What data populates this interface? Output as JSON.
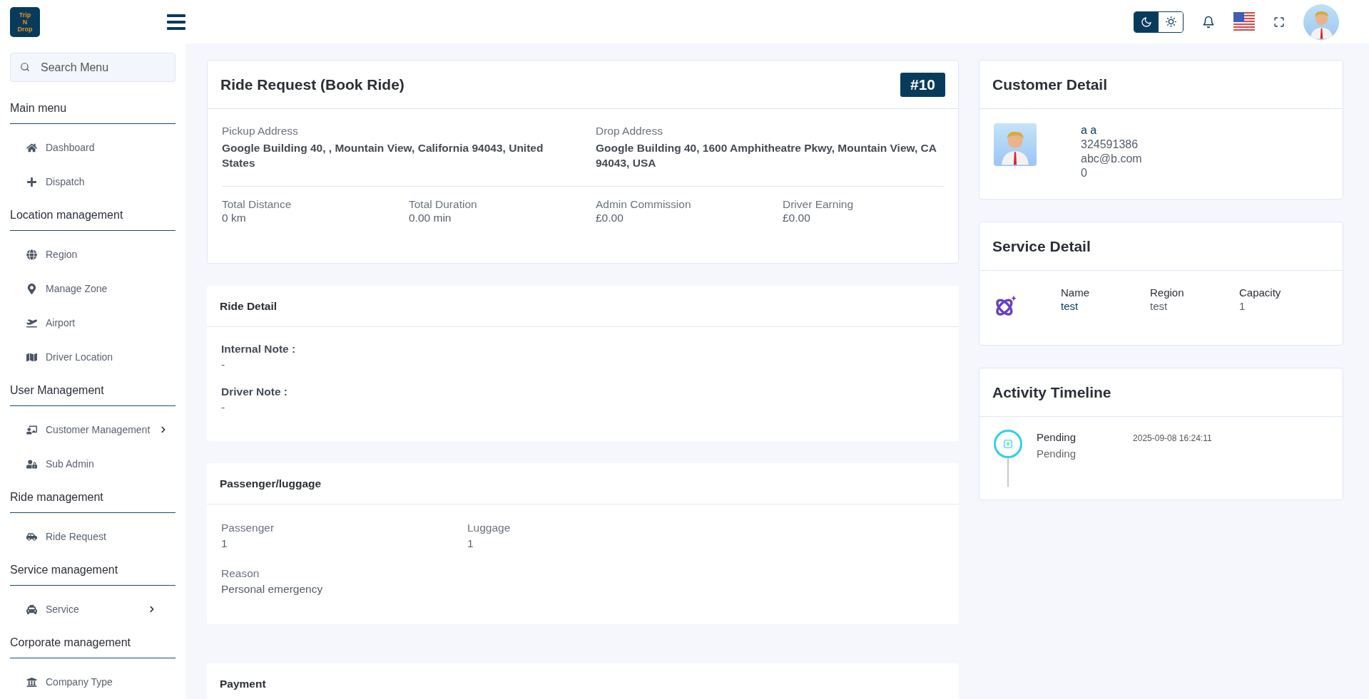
{
  "brand": {
    "logo_lines": [
      "Trip",
      "N",
      "Drop"
    ]
  },
  "header": {
    "theme_toggle": [
      {
        "kind": "moon",
        "selected": true
      },
      {
        "kind": "sun",
        "selected": false
      }
    ]
  },
  "sidebar": {
    "search": {
      "placeholder": "Search Menu"
    },
    "sections": [
      {
        "title": "Main menu",
        "items": [
          {
            "label": "Dashboard",
            "expandable": false
          },
          {
            "label": "Dispatch",
            "expandable": false
          }
        ]
      },
      {
        "title": "Location management",
        "items": [
          {
            "label": "Region",
            "expandable": false
          },
          {
            "label": "Manage Zone",
            "expandable": false
          },
          {
            "label": "Airport",
            "expandable": false
          },
          {
            "label": "Driver Location",
            "expandable": false
          }
        ]
      },
      {
        "title": "User Management",
        "items": [
          {
            "label": "Customer Management",
            "expandable": true
          },
          {
            "label": "Sub Admin",
            "expandable": false
          }
        ]
      },
      {
        "title": "Ride management",
        "items": [
          {
            "label": "Ride Request",
            "expandable": false
          }
        ]
      },
      {
        "title": "Service management",
        "items": [
          {
            "label": "Service",
            "expandable": true
          }
        ]
      },
      {
        "title": "Corporate management",
        "items": [
          {
            "label": "Company Type",
            "expandable": false
          }
        ]
      }
    ]
  },
  "ride_card": {
    "title": "Ride Request (Book Ride)",
    "badge": "#10",
    "addresses": [
      {
        "label": "Pickup Address",
        "value": "Google Building 40, , Mountain View, California 94043, United States"
      },
      {
        "label": "Drop Address",
        "value": "Google Building 40, 1600 Amphitheatre Pkwy, Mountain View, CA 94043, USA"
      }
    ],
    "stats": [
      {
        "label": "Total Distance",
        "value": "0 km"
      },
      {
        "label": "Total Duration",
        "value": "0.00 min"
      },
      {
        "label": "Admin Commission",
        "value": "£0.00"
      },
      {
        "label": "Driver Earning",
        "value": "£0.00"
      }
    ]
  },
  "ride_detail": {
    "title": "Ride Detail",
    "notes": [
      {
        "label": "Internal Note :",
        "value": "-"
      },
      {
        "label": "Driver Note :",
        "value": "-"
      }
    ]
  },
  "passenger": {
    "title": "Passenger/luggage",
    "fields": [
      {
        "label": "Passenger",
        "value": "1"
      },
      {
        "label": "Luggage",
        "value": "1"
      }
    ],
    "reason": {
      "label": "Reason",
      "value": "Personal emergency"
    }
  },
  "payment": {
    "title": "Payment"
  },
  "customer_detail": {
    "title": "Customer Detail",
    "lines": [
      "a a",
      "324591386",
      "abc@b.com",
      "0"
    ]
  },
  "service_detail": {
    "title": "Service Detail",
    "fields": [
      {
        "label": "Name",
        "value": "test"
      },
      {
        "label": "Region",
        "value": "test"
      },
      {
        "label": "Capacity",
        "value": "1"
      }
    ]
  },
  "activity_timeline": {
    "title": "Activity Timeline",
    "events": [
      {
        "status": "Pending",
        "note": "Pending",
        "time": "2025-09-08 16:24:11"
      }
    ]
  }
}
